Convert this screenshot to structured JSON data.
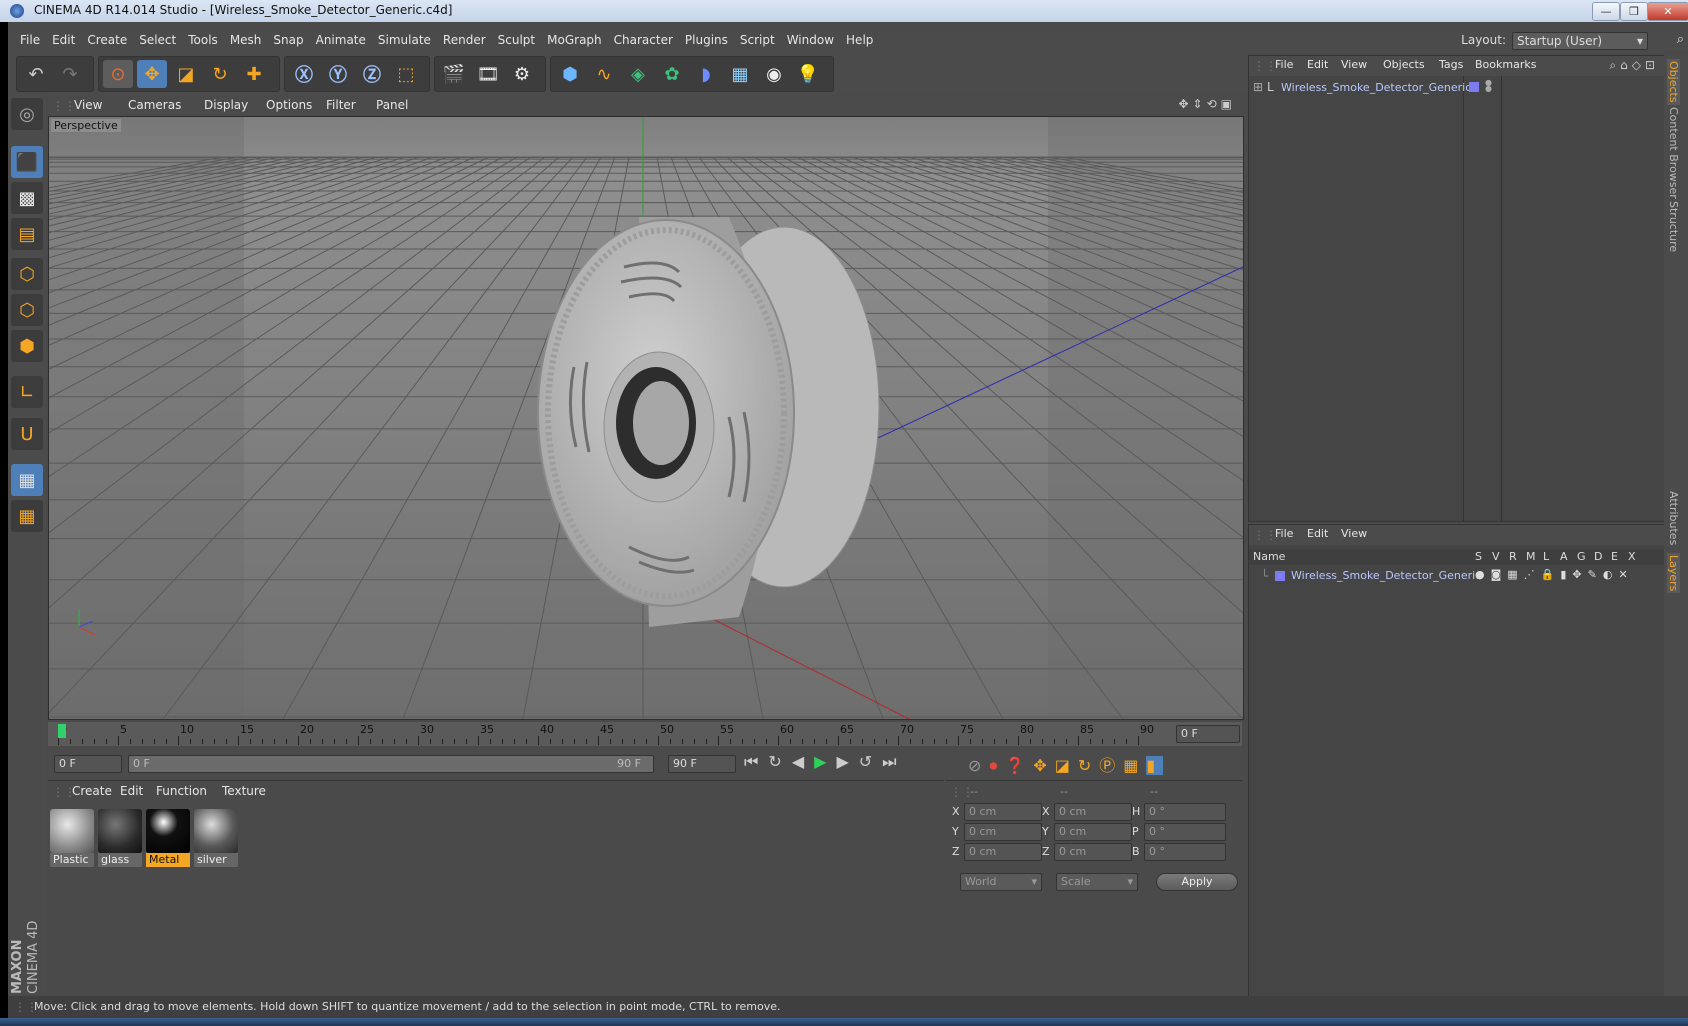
{
  "window": {
    "title": "CINEMA 4D R14.014 Studio - [Wireless_Smoke_Detector_Generic.c4d]",
    "minimize": "—",
    "restore": "❐",
    "close": "✕"
  },
  "menubar": {
    "items": [
      "File",
      "Edit",
      "Create",
      "Select",
      "Tools",
      "Mesh",
      "Snap",
      "Animate",
      "Simulate",
      "Render",
      "Sculpt",
      "MoGraph",
      "Character",
      "Plugins",
      "Script",
      "Window",
      "Help"
    ],
    "layout_label": "Layout:",
    "layout_value": "Startup (User)"
  },
  "viewport": {
    "menu": [
      "View",
      "Cameras",
      "Display",
      "Options",
      "Filter",
      "Panel"
    ],
    "label": "Perspective"
  },
  "timeline": {
    "ticks": [
      "0",
      "5",
      "10",
      "15",
      "20",
      "25",
      "30",
      "35",
      "40",
      "45",
      "50",
      "55",
      "60",
      "65",
      "70",
      "75",
      "80",
      "85",
      "90"
    ],
    "current_frame": "0 F",
    "start_field": "0 F",
    "range_start": "0 F",
    "range_end": "90 F",
    "end_field": "90 F"
  },
  "materials": {
    "menu": [
      "Create",
      "Edit",
      "Function",
      "Texture"
    ],
    "items": [
      {
        "name": "Plastic"
      },
      {
        "name": "glass"
      },
      {
        "name": "Metal"
      },
      {
        "name": "silver"
      }
    ]
  },
  "coordinates": {
    "header": [
      "--",
      "--",
      "--"
    ],
    "rows": [
      {
        "a": "X",
        "av": "0 cm",
        "b": "X",
        "bv": "0 cm",
        "c": "H",
        "cv": "0 °"
      },
      {
        "a": "Y",
        "av": "0 cm",
        "b": "Y",
        "bv": "0 cm",
        "c": "P",
        "cv": "0 °"
      },
      {
        "a": "Z",
        "av": "0 cm",
        "b": "Z",
        "bv": "0 cm",
        "c": "B",
        "cv": "0 °"
      }
    ],
    "world": "World",
    "scale": "Scale",
    "apply": "Apply"
  },
  "objects_panel": {
    "menu": [
      "File",
      "Edit",
      "View",
      "Objects",
      "Tags",
      "Bookmarks"
    ],
    "object_name": "Wireless_Smoke_Detector_Generic"
  },
  "layers_panel": {
    "menu": [
      "File",
      "Edit",
      "View"
    ],
    "name_header": "Name",
    "flag_headers": [
      "S",
      "V",
      "R",
      "M",
      "L",
      "A",
      "G",
      "D",
      "E",
      "X"
    ],
    "layer_name": "Wireless_Smoke_Detector_Generic"
  },
  "side_tabs": [
    "Objects",
    "Content Browser",
    "Structure",
    "Attributes",
    "Layers"
  ],
  "status": "Move: Click and drag to move elements. Hold down SHIFT to quantize movement / add to the selection in point mode, CTRL to remove.",
  "brand": {
    "maxon": "MAXON",
    "cinema": "CINEMA 4D"
  },
  "colors": {
    "accent": "#f5a623",
    "active_tool": "#4f7fb8",
    "layer_color": "#7c7cf0"
  }
}
